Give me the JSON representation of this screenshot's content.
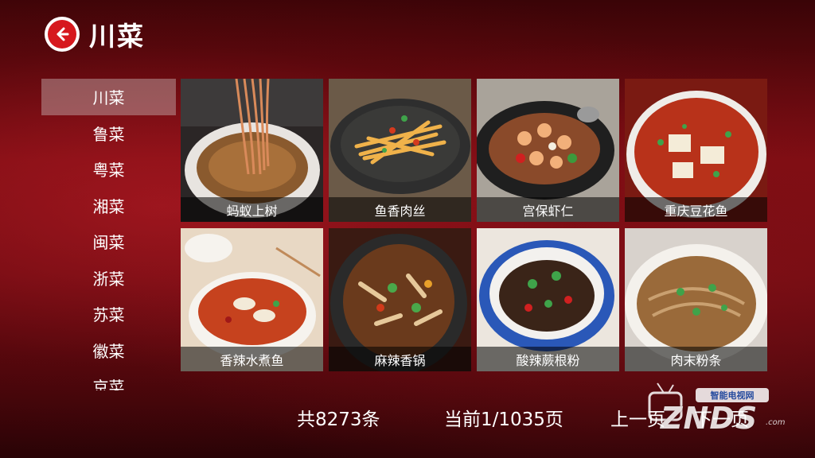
{
  "header": {
    "title": "川菜",
    "back_icon": "back-arrow-icon"
  },
  "sidebar": {
    "items": [
      {
        "label": "川菜",
        "active": true
      },
      {
        "label": "鲁菜"
      },
      {
        "label": "粤菜"
      },
      {
        "label": "湘菜"
      },
      {
        "label": "闽菜"
      },
      {
        "label": "浙菜"
      },
      {
        "label": "苏菜"
      },
      {
        "label": "徽菜"
      },
      {
        "label": "京菜"
      }
    ]
  },
  "dishes": [
    {
      "label": "蚂蚁上树"
    },
    {
      "label": "鱼香肉丝"
    },
    {
      "label": "宫保虾仁"
    },
    {
      "label": "重庆豆花鱼"
    },
    {
      "label": "香辣水煮鱼"
    },
    {
      "label": "麻辣香锅"
    },
    {
      "label": "酸辣蕨根粉"
    },
    {
      "label": "肉末粉条"
    }
  ],
  "footer": {
    "total": "共8273条",
    "page_info": "当前1/1035页",
    "prev": "上一页",
    "next": "下一页"
  },
  "watermark": {
    "badge": "智能电视网",
    "text": "ZNDS",
    "suffix": ".com"
  },
  "colors": {
    "accent": "#d6181e",
    "background": "#7a0c12"
  }
}
